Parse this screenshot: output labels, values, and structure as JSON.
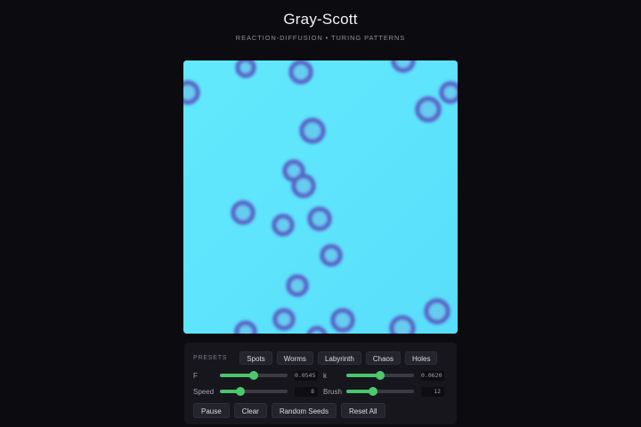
{
  "header": {
    "title": "Gray-Scott",
    "subtitle": "REACTION-DIFFUSION • TURING PATTERNS"
  },
  "colors": {
    "background": "#0c0c10",
    "field": "#5fe6fb",
    "spot": "#5a63c8",
    "accent": "#4bc46a"
  },
  "presets": {
    "label": "PRESETS",
    "items": [
      "Spots",
      "Worms",
      "Labyrinth",
      "Chaos",
      "Holes"
    ]
  },
  "params": {
    "f": {
      "label": "F",
      "value": "0.0545",
      "fraction": 0.5
    },
    "k": {
      "label": "k",
      "value": "0.0620",
      "fraction": 0.5
    },
    "speed": {
      "label": "Speed",
      "value": "8",
      "fraction": 0.3
    },
    "brush": {
      "label": "Brush",
      "value": "12",
      "fraction": 0.4
    }
  },
  "actions": {
    "pause": "Pause",
    "clear": "Clear",
    "random_seeds": "Random Seeds",
    "reset_all": "Reset All"
  }
}
